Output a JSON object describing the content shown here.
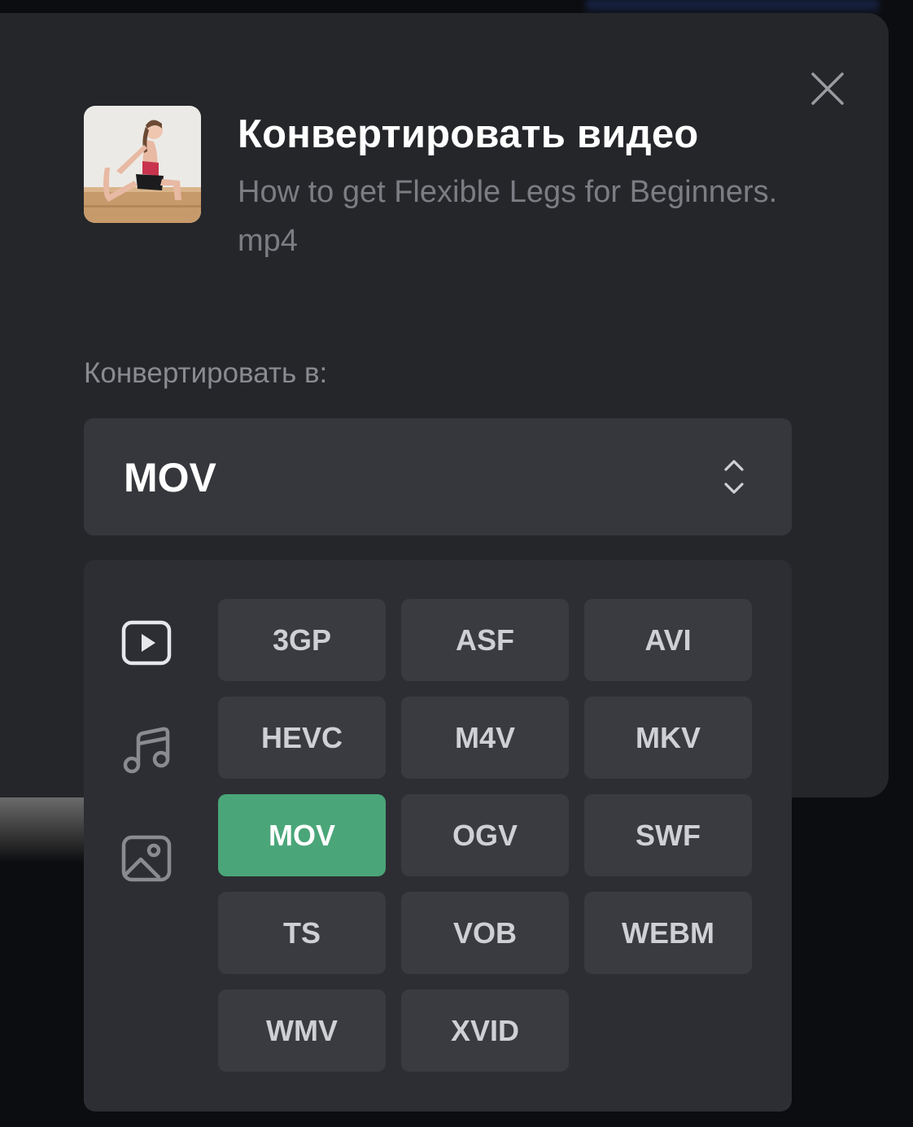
{
  "dialog": {
    "title": "Конвертировать видео",
    "filename": "How to get Flexible Legs for Beginners.mp4",
    "close_icon": "close-icon",
    "thumbnail_icon": "video-thumbnail"
  },
  "convert": {
    "label": "Конвертировать в:",
    "selected": "MOV",
    "select_icon": "chevron-up-down-icon"
  },
  "categories": [
    {
      "name": "video",
      "icon": "video-icon",
      "active": true
    },
    {
      "name": "audio",
      "icon": "music-icon",
      "active": false
    },
    {
      "name": "image",
      "icon": "image-icon",
      "active": false
    }
  ],
  "formats": [
    "3GP",
    "ASF",
    "AVI",
    "HEVC",
    "M4V",
    "MKV",
    "MOV",
    "OGV",
    "SWF",
    "TS",
    "VOB",
    "WEBM",
    "WMV",
    "XVID"
  ],
  "colors": {
    "accent": "#4aa679",
    "panel": "#25262a",
    "button": "#3a3b40"
  }
}
